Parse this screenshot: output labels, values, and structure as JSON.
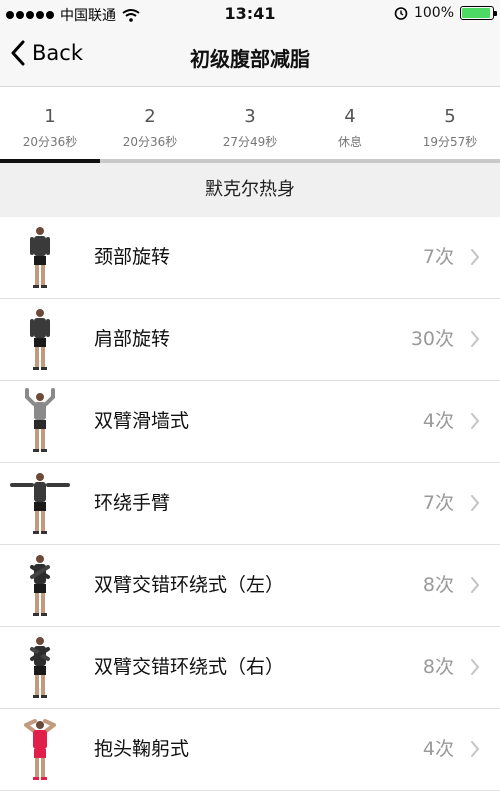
{
  "status_bar": {
    "carrier": "中国联通",
    "time": "13:41",
    "battery": "100%",
    "icons": [
      "signal-dots-icon",
      "wifi-icon",
      "alarm-icon",
      "battery-icon"
    ]
  },
  "nav": {
    "back_label": "Back",
    "title": "初级腹部减脂"
  },
  "tabs": [
    {
      "num": "1",
      "sub": "20分36秒"
    },
    {
      "num": "2",
      "sub": "20分36秒"
    },
    {
      "num": "3",
      "sub": "27分49秒"
    },
    {
      "num": "4",
      "sub": "休息"
    },
    {
      "num": "5",
      "sub": "19分57秒"
    }
  ],
  "selected_tab": 1,
  "section_title": "默克尔热身",
  "exercises": [
    {
      "name": "颈部旋转",
      "count": "7次",
      "figure": "standing-figure"
    },
    {
      "name": "肩部旋转",
      "count": "30次",
      "figure": "standing-figure"
    },
    {
      "name": "双臂滑墙式",
      "count": "4次",
      "figure": "arms-up-figure"
    },
    {
      "name": "环绕手臂",
      "count": "7次",
      "figure": "arms-out-figure"
    },
    {
      "name": "双臂交错环绕式（左）",
      "count": "8次",
      "figure": "arms-crossed-figure"
    },
    {
      "name": "双臂交错环绕式（右）",
      "count": "8次",
      "figure": "arms-crossed-figure"
    },
    {
      "name": "抱头鞠躬式",
      "count": "4次",
      "figure": "hands-behind-head-figure"
    }
  ],
  "colors": {
    "battery": "#4cd964",
    "tab_indicator": "#111111",
    "count_text": "#9a9a9a",
    "figure_shirt": "#3a3a3a",
    "figure_shirt_alt": "#e0204a"
  }
}
